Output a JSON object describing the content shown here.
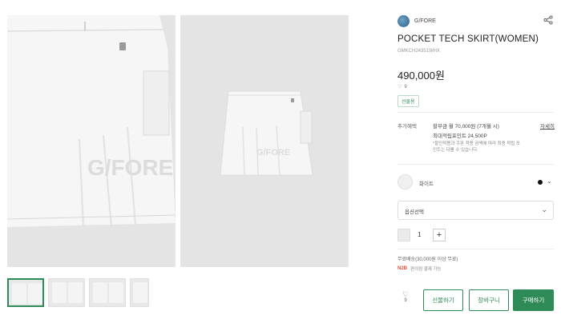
{
  "brand": {
    "name": "G/FORE"
  },
  "product": {
    "title": "POCKET TECH SKIRT(WOMEN)",
    "sku": "GMKCH24351WHX",
    "price": "490,000원",
    "likes": "9",
    "badge": "선물용"
  },
  "benefits": {
    "label": "추가혜택",
    "line1": "할부금 월 70,000원 (7개월 시)",
    "line2": "최대적립포인트 24,500P",
    "note": "*할인적용과 쿠폰 적용 금액에 따라 최종 적립 포인트는 다를 수 있습니다.",
    "more": "자세히"
  },
  "options": {
    "color_name": "화이트",
    "select_label": "옵션선택",
    "quantity": "1"
  },
  "shipping": {
    "text": "무료배송(30,000원 이상 무료)",
    "pay_logo": "N2B",
    "pay_text": "편의점 결제 가능"
  },
  "actions": {
    "wish_count": "9",
    "gift_label": "선물하기",
    "cart_label": "장바구니",
    "buy_label": "구매하기"
  },
  "colors": {
    "accent": "#2e8b57",
    "selected_color": "#111111"
  },
  "icons": [
    "share-icon",
    "heart-icon",
    "chevron-down-icon",
    "plus-icon",
    "minus-icon"
  ]
}
